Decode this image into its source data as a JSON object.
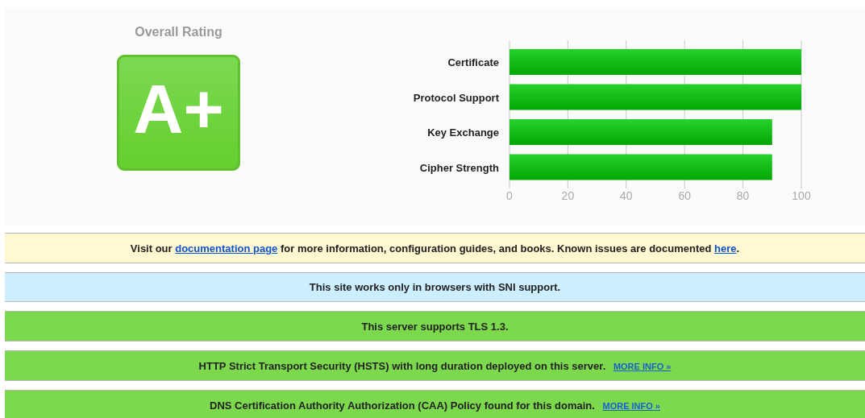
{
  "rating": {
    "title": "Overall Rating",
    "grade": "A+"
  },
  "scores": {
    "chart_data": {
      "type": "bar",
      "orientation": "horizontal",
      "categories": [
        "Certificate",
        "Protocol Support",
        "Key Exchange",
        "Cipher Strength"
      ],
      "values": [
        100,
        100,
        90,
        90
      ],
      "xlim": [
        0,
        100
      ],
      "xticks": [
        0,
        20,
        40,
        60,
        80,
        100
      ],
      "grid": true
    }
  },
  "notices": [
    {
      "kind": "warning",
      "segments": [
        {
          "text": "Visit our "
        },
        {
          "text": "documentation page",
          "kind": "link"
        },
        {
          "text": " for more information, configuration guides, and books. Known issues are documented "
        },
        {
          "text": "here",
          "kind": "link"
        },
        {
          "text": "."
        }
      ]
    },
    {
      "kind": "info",
      "segments": [
        {
          "text": "This site works only in browsers with SNI support."
        }
      ]
    },
    {
      "kind": "good",
      "segments": [
        {
          "text": "This server supports TLS 1.3."
        }
      ]
    },
    {
      "kind": "good",
      "segments": [
        {
          "text": "HTTP Strict Transport Security (HSTS) with long duration deployed on this server. "
        },
        {
          "text": "MORE INFO »",
          "kind": "more_link"
        }
      ]
    },
    {
      "kind": "good",
      "segments": [
        {
          "text": "DNS Certification Authority Authorization (CAA) Policy found for this domain. "
        },
        {
          "text": "MORE INFO »",
          "kind": "more_link"
        }
      ]
    }
  ]
}
